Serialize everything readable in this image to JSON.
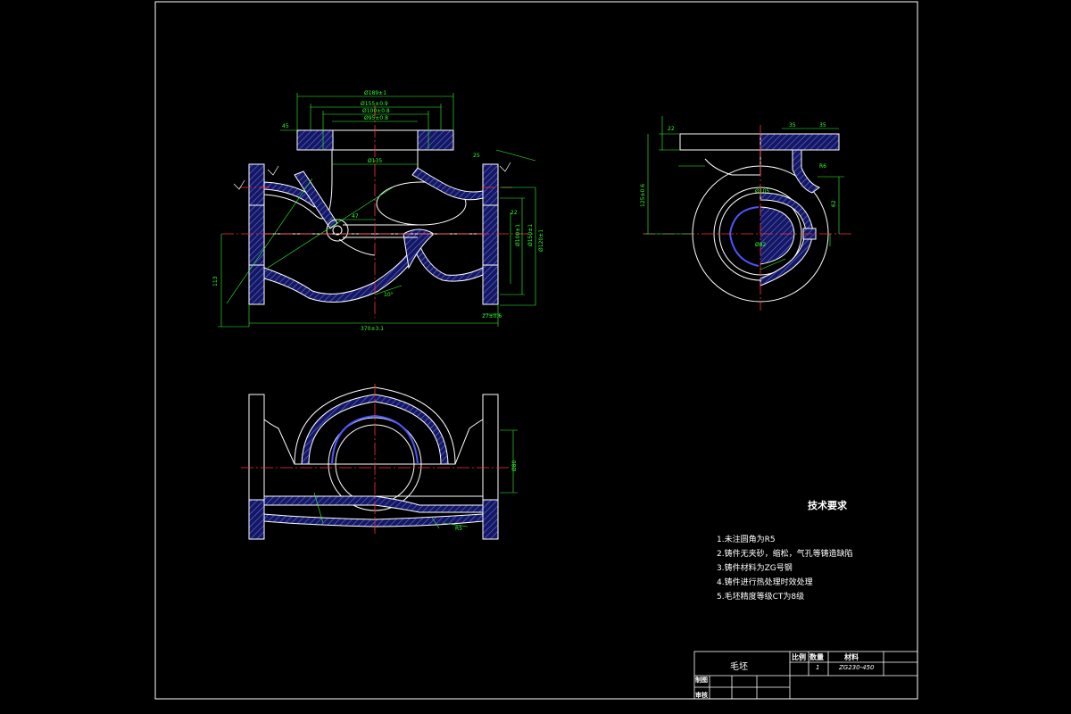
{
  "tech_requirements": {
    "title": "技术要求",
    "items": [
      "1.未注圆角为R5",
      "2.铸件无夹砂，缩松，气孔等铸造缺陷",
      "3.铸件材料为ZG号钢",
      "4.铸件进行热处理时效处理",
      "5.毛坯精度等级CT为8级"
    ]
  },
  "title_block": {
    "part_name": "毛坯",
    "scale_label": "比例",
    "quantity_label": "数量",
    "material_label": "材料",
    "quantity_value": "1",
    "material_value": "ZG230-450",
    "drawn_label": "制图",
    "checked_label": "审核"
  },
  "dimensions": {
    "front_top_width": "Ø189±1",
    "front_bore_1": "Ø155±0.9",
    "front_bore_2": "Ø100±0.8",
    "front_bore_3": "Ø95±0.8",
    "front_inner": "Ø135",
    "front_thk_top": "45",
    "front_r25": "25",
    "front_47": "47",
    "front_height": "113",
    "front_overall": "370±3.1",
    "front_right_1": "22",
    "front_right_2": "Ø120±1",
    "front_right_3": "Ø100±1",
    "front_right_4": "Ø150±1",
    "front_right_5": "27±0.6",
    "front_angle": "10°",
    "side_height": "125±0.6",
    "side_top": "22",
    "side_top_r": "35",
    "side_top_r2": "35",
    "side_d105": "Ø105",
    "side_d82": "Ø82",
    "side_r86": "R6",
    "side_62": "62",
    "top_d80": "Ø80",
    "top_r65": "R5"
  },
  "colors": {
    "background": "#000000",
    "frame": "#ffffff",
    "geometry": "#ffffff",
    "dimension": "#33ff33",
    "centerline": "#ff3333",
    "hatch": "#4b55ff",
    "section_fill": "#1a1d66"
  }
}
